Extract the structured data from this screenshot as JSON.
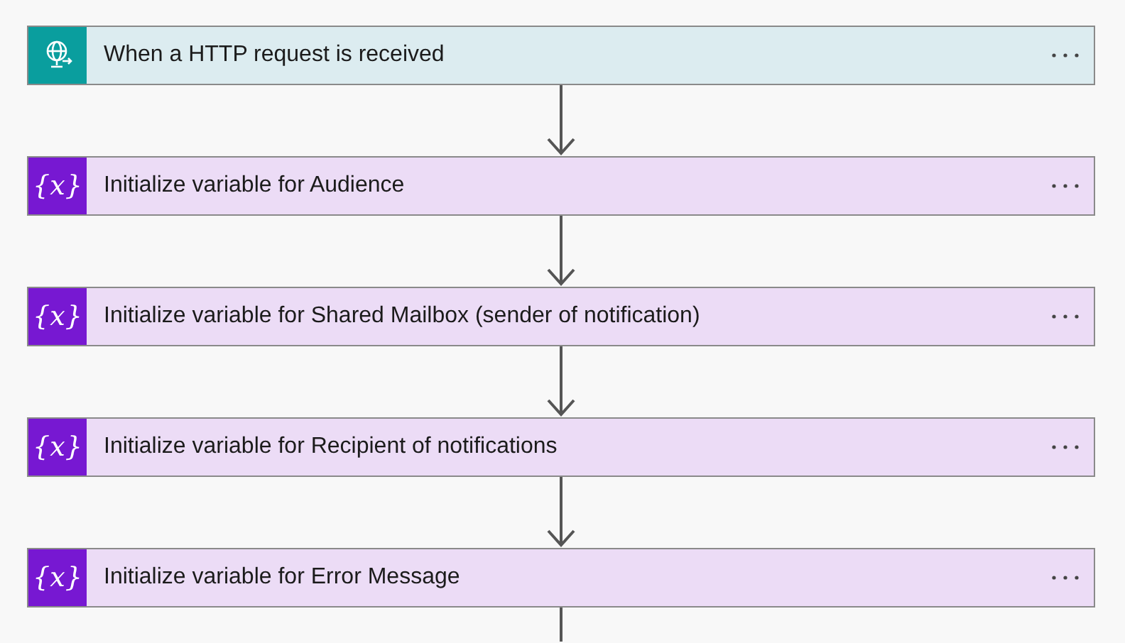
{
  "steps": [
    {
      "kind": "trigger",
      "title": "When a HTTP request is received"
    },
    {
      "kind": "variable",
      "icon": "{x}",
      "title": "Initialize variable for Audience"
    },
    {
      "kind": "variable",
      "icon": "{x}",
      "title": "Initialize variable for Shared Mailbox (sender of notification)"
    },
    {
      "kind": "variable",
      "icon": "{x}",
      "title": "Initialize variable for Recipient of notifications"
    },
    {
      "kind": "variable",
      "icon": "{x}",
      "title": "Initialize variable for Error Message"
    }
  ]
}
